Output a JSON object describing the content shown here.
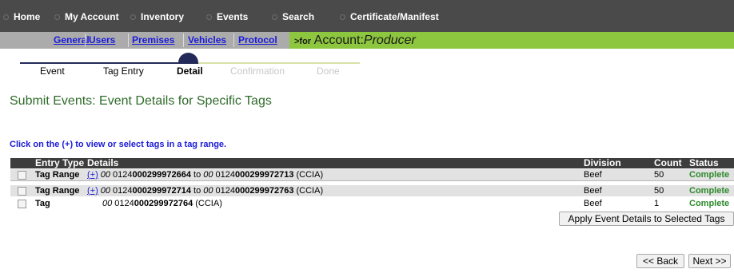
{
  "topnav": {
    "items": [
      "Home",
      "My Account",
      "Inventory",
      "Events",
      "Search",
      "Certificate/Manifest"
    ]
  },
  "subnav": {
    "links": [
      "General",
      "Users",
      "Premises",
      "Vehicles",
      "Protocol"
    ],
    "for_label": ">for",
    "account_label": "Account:",
    "account_value": "Producer"
  },
  "steps": {
    "labels": [
      "Event",
      "Tag Entry",
      "Detail",
      "Confirmation",
      "Done"
    ]
  },
  "page_title": "Submit Events: Event Details for Specific Tags",
  "instruction": "Click on the (+) to view or select tags in a tag range.",
  "table": {
    "headers": [
      "Entry Type",
      "Details",
      "Division",
      "Count",
      "Status"
    ],
    "rows": [
      {
        "type": "Tag Range",
        "plus": "(+)",
        "from_prefix": "00",
        "from_mid": " 0124",
        "from_num": "000299972664",
        "to_word": " to ",
        "to_prefix": "00",
        "to_mid": " 0124",
        "to_num": "000299972713",
        "suffix": " (CCIA)",
        "division": "Beef",
        "count": "50",
        "status": "Complete"
      },
      {
        "type": "Tag Range",
        "plus": "(+)",
        "from_prefix": "00",
        "from_mid": " 0124",
        "from_num": "000299972714",
        "to_word": " to ",
        "to_prefix": "00",
        "to_mid": " 0124",
        "to_num": "000299972763",
        "suffix": " (CCIA)",
        "division": "Beef",
        "count": "50",
        "status": "Complete"
      },
      {
        "type": "Tag",
        "from_prefix": "00",
        "from_mid": " 0124",
        "from_num": "000299972764",
        "suffix": " (CCIA)",
        "division": "Beef",
        "count": "1",
        "status": "Complete"
      }
    ]
  },
  "apply_button": "Apply Event Details to Selected Tags",
  "back_button": "<< Back",
  "next_button": "Next >>"
}
